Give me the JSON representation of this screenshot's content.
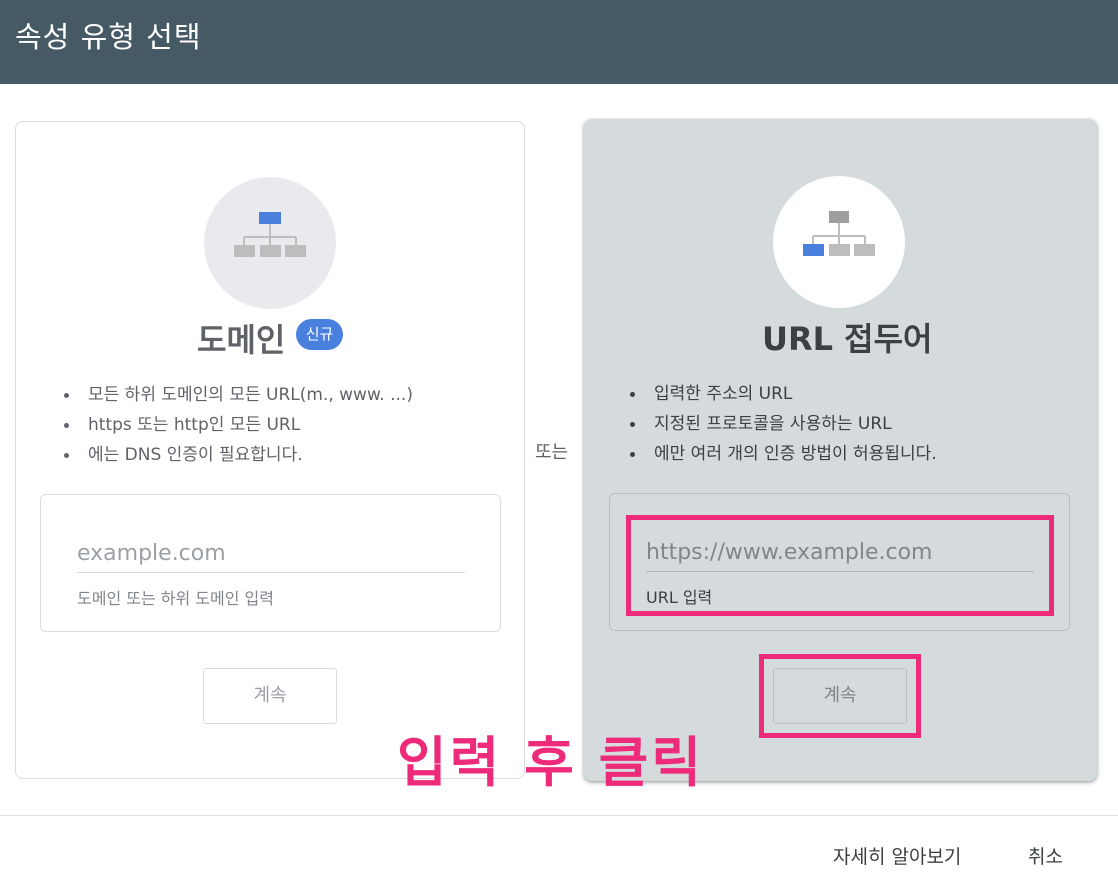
{
  "dialog": {
    "title": "속성 유형 선택"
  },
  "or_label": "또는",
  "domain_card": {
    "icon": "sitemap-top-node-icon",
    "title": "도메인",
    "badge": "신규",
    "bullets": [
      "모든 하위 도메인의 모든 URL(m., www. ...)",
      "https 또는 http인 모든 URL",
      "에는 DNS 인증이 필요합니다."
    ],
    "input_placeholder": "example.com",
    "input_helper": "도메인 또는 하위 도메인 입력",
    "continue_label": "계속"
  },
  "url_card": {
    "icon": "sitemap-leaf-node-icon",
    "title": "URL 접두어",
    "bullets": [
      "입력한 주소의 URL",
      "지정된 프로토콜을 사용하는 URL",
      "에만 여러 개의 인증 방법이 허용됩니다."
    ],
    "input_placeholder": "https://www.example.com",
    "input_helper": "URL 입력",
    "continue_label": "계속"
  },
  "annotation": {
    "text": "입력 후 클릭",
    "color": "#ee2a7b"
  },
  "footer": {
    "learn_more": "자세히 알아보기",
    "cancel": "취소"
  },
  "colors": {
    "header": "#455a64",
    "accent": "#4a80dd",
    "highlight": "#ee2a7b"
  }
}
